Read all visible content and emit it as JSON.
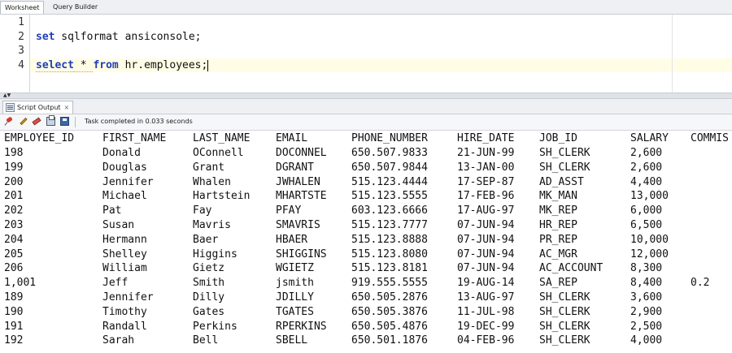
{
  "top_tabs": [
    "Worksheet",
    "Query Builder"
  ],
  "editor": {
    "line_numbers": [
      "1",
      "2",
      "3",
      "4"
    ],
    "line2": {
      "kw": "set",
      "rest": " sqlformat ansiconsole;"
    },
    "line4": {
      "kw1": "select",
      "star": " * ",
      "kw2": "from",
      "rest": " hr.employees;"
    }
  },
  "output_tab": {
    "label": "Script Output",
    "close": "×"
  },
  "toolbar": {
    "icons": [
      "pin-icon",
      "pencil-icon",
      "eraser-icon",
      "print-icon",
      "save-icon"
    ],
    "status": "Task completed in 0.033 seconds"
  },
  "results": {
    "headers": [
      "EMPLOYEE_ID",
      "FIRST_NAME",
      "LAST_NAME",
      "EMAIL",
      "PHONE_NUMBER",
      "HIRE_DATE",
      "JOB_ID",
      "SALARY",
      "COMMIS"
    ],
    "rows": [
      [
        "198",
        "Donald",
        "OConnell",
        "DOCONNEL",
        "650.507.9833",
        "21-JUN-99",
        "SH_CLERK",
        "2,600",
        ""
      ],
      [
        "199",
        "Douglas",
        "Grant",
        "DGRANT",
        "650.507.9844",
        "13-JAN-00",
        "SH_CLERK",
        "2,600",
        ""
      ],
      [
        "200",
        "Jennifer",
        "Whalen",
        "JWHALEN",
        "515.123.4444",
        "17-SEP-87",
        "AD_ASST",
        "4,400",
        ""
      ],
      [
        "201",
        "Michael",
        "Hartstein",
        "MHARTSTE",
        "515.123.5555",
        "17-FEB-96",
        "MK_MAN",
        "13,000",
        ""
      ],
      [
        "202",
        "Pat",
        "Fay",
        "PFAY",
        "603.123.6666",
        "17-AUG-97",
        "MK_REP",
        "6,000",
        ""
      ],
      [
        "203",
        "Susan",
        "Mavris",
        "SMAVRIS",
        "515.123.7777",
        "07-JUN-94",
        "HR_REP",
        "6,500",
        ""
      ],
      [
        "204",
        "Hermann",
        "Baer",
        "HBAER",
        "515.123.8888",
        "07-JUN-94",
        "PR_REP",
        "10,000",
        ""
      ],
      [
        "205",
        "Shelley",
        "Higgins",
        "SHIGGINS",
        "515.123.8080",
        "07-JUN-94",
        "AC_MGR",
        "12,000",
        ""
      ],
      [
        "206",
        "William",
        "Gietz",
        "WGIETZ",
        "515.123.8181",
        "07-JUN-94",
        "AC_ACCOUNT",
        "8,300",
        ""
      ],
      [
        "1,001",
        "Jeff",
        "Smith",
        "jsmith",
        "919.555.5555",
        "19-AUG-14",
        "SA_REP",
        "8,400",
        "0.2"
      ],
      [
        "189",
        "Jennifer",
        "Dilly",
        "JDILLY",
        "650.505.2876",
        "13-AUG-97",
        "SH_CLERK",
        "3,600",
        ""
      ],
      [
        "190",
        "Timothy",
        "Gates",
        "TGATES",
        "650.505.3876",
        "11-JUL-98",
        "SH_CLERK",
        "2,900",
        ""
      ],
      [
        "191",
        "Randall",
        "Perkins",
        "RPERKINS",
        "650.505.4876",
        "19-DEC-99",
        "SH_CLERK",
        "2,500",
        ""
      ],
      [
        "192",
        "Sarah",
        "Bell",
        "SBELL",
        "650.501.1876",
        "04-FEB-96",
        "SH_CLERK",
        "4,000",
        ""
      ]
    ]
  }
}
